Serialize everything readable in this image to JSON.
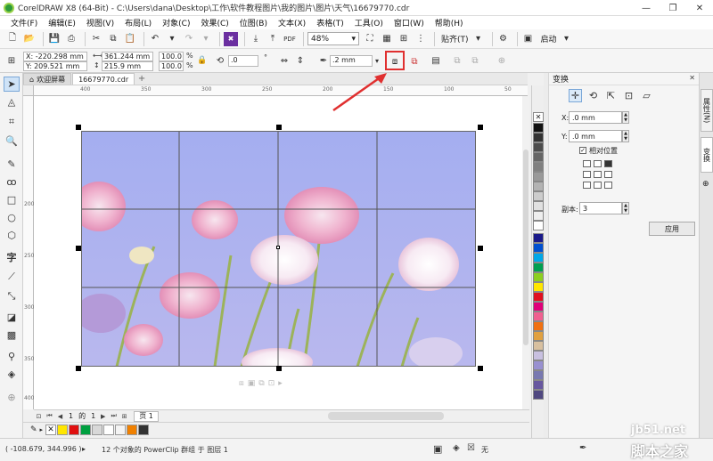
{
  "window": {
    "title": "CorelDRAW X8 (64-Bit) - C:\\Users\\dana\\Desktop\\工作\\软件教程图片\\我的图片\\图片\\天气\\16679770.cdr",
    "min": "—",
    "max": "❐",
    "close": "✕"
  },
  "menu": [
    "文件(F)",
    "编辑(E)",
    "视图(V)",
    "布局(L)",
    "对象(C)",
    "效果(C)",
    "位图(B)",
    "文本(X)",
    "表格(T)",
    "工具(O)",
    "窗口(W)",
    "帮助(H)"
  ],
  "toolbar": {
    "zoom": "48%",
    "snap_label": "贴齐(T)",
    "launch_label": "启动"
  },
  "propbar": {
    "x": "X: -220.298 mm",
    "y": "Y: 209.521 mm",
    "w": "361.244 mm",
    "h": "215.9 mm",
    "sx": "100.0",
    "sy": "100.0",
    "pct1": "%",
    "pct2": "%",
    "angle": ".0",
    "outline": ".2 mm",
    "deg": "°"
  },
  "tabs": {
    "welcome": "欢迎屏幕",
    "doc": "16679770.cdr",
    "plus": "+"
  },
  "rulers": {
    "h": [
      "400",
      "350",
      "300",
      "250",
      "200",
      "150",
      "100",
      "50"
    ],
    "v": [
      "200",
      "250",
      "300",
      "350",
      "400"
    ]
  },
  "page_nav": {
    "current": "1",
    "of": "的",
    "total": "1",
    "page_tab": "页 1"
  },
  "status": {
    "coords": "( -108.679, 344.996 )",
    "info": "12 个对象的 PowerClip 群组 于 图层 1",
    "fill_none": "无"
  },
  "docker": {
    "title": "变换",
    "x_label": "X:",
    "x_value": ".0 mm",
    "y_label": "Y:",
    "y_value": ".0 mm",
    "relative_label": "相对位置",
    "copies_label": "副本:",
    "copies_value": "3",
    "apply": "应用"
  },
  "side_tabs": [
    "属性(N)",
    "变换"
  ],
  "watermark": {
    "line1": "jb51.net",
    "line2": "脚本之家"
  },
  "colors": {
    "highlight": "#e03030",
    "arrow": "#e03030"
  }
}
